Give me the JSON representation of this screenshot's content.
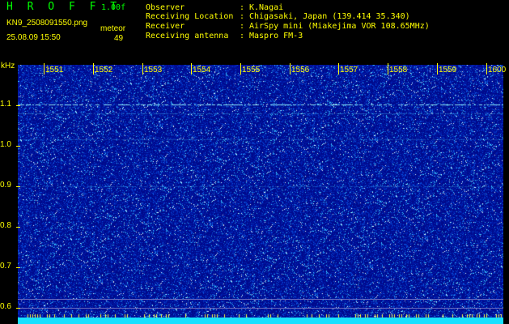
{
  "header": {
    "app_title": "H R O F F T",
    "version": "1.00f",
    "filename": "KN9_2508091550.png",
    "datetime": "25.08.09 15:50",
    "meteor_label": "meteor",
    "meteor_count": "49"
  },
  "info": [
    {
      "label": "Observer",
      "sep": ":",
      "value": "K.Nagai"
    },
    {
      "label": "Receiving Location",
      "sep": ":",
      "value": "Chigasaki, Japan (139.414 35.340)"
    },
    {
      "label": "Receiver",
      "sep": ":",
      "value": "AirSpy mini (Miakejima VOR 108.65MHz)"
    },
    {
      "label": "Receiving antenna",
      "sep": ":",
      "value": "Maspro FM-3"
    }
  ],
  "axis": {
    "y_unit": "kHz",
    "x_ticks": [
      "1551",
      "1552",
      "1553",
      "1554",
      "1555",
      "1556",
      "1557",
      "1558",
      "1559",
      "1600"
    ],
    "y_ticks": [
      "1.1",
      "1.0",
      "0.9",
      "0.8",
      "0.7",
      "0.6"
    ]
  },
  "colors": {
    "label_yellow": "#ffff00",
    "title_green": "#00ff00",
    "background_blue": "#000c8c",
    "band_cyan": "#18e0ff"
  }
}
